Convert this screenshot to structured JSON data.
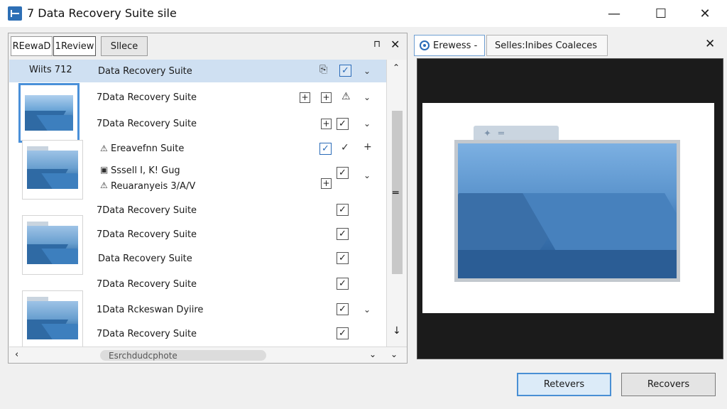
{
  "window": {
    "title": "7 Data Recovery Suite sile"
  },
  "left_pane": {
    "tabs": [
      "REewaD",
      "1Review",
      "Sllece"
    ],
    "list_header": "Wiits 712",
    "hscroll_label": "Esrchdudcphote",
    "items": [
      {
        "name": "Data Recovery Suite"
      },
      {
        "name": "7Data Recovery Suite"
      },
      {
        "name": "7Data Recovery Suite"
      },
      {
        "name": "Ereavefnn Suite"
      },
      {
        "name": "Sssell I, K! Gug"
      },
      {
        "name": "Reuaranyeis 3/A/V"
      },
      {
        "name": "7Data Recovery Suite"
      },
      {
        "name": "7Data Recovery Suite"
      },
      {
        "name": "Data Recovery Suite"
      },
      {
        "name": "7Data Recovery Suite"
      },
      {
        "name": "1Data Rckeswan Dyiire"
      },
      {
        "name": "7Data Recovery Suite"
      }
    ]
  },
  "right_pane": {
    "tabs": [
      "Erewess -",
      "Selles:Inibes Coaleces"
    ]
  },
  "buttons": {
    "retevers": "Retevers",
    "recovers": "Recovers"
  },
  "colors": {
    "accent": "#4a90d9",
    "selected_row": "#cfe0f2",
    "preview_bg": "#1b1b1b"
  }
}
